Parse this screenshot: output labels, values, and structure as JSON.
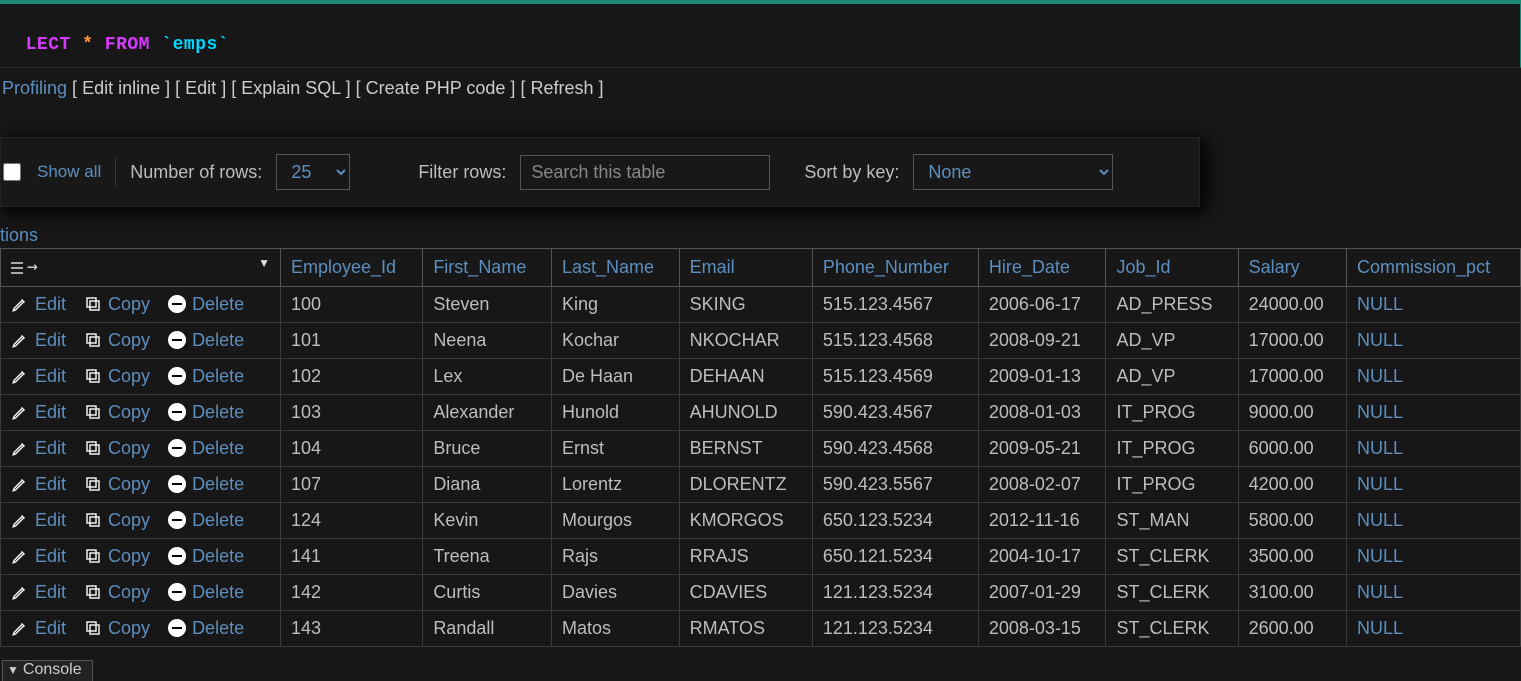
{
  "sql": {
    "kw1": "LECT",
    "star": "*",
    "kw2": "FROM",
    "ident": "`emps`"
  },
  "actions_bar": {
    "profiling": "Profiling",
    "edit_inline": "Edit inline",
    "edit": "Edit",
    "explain": "Explain SQL",
    "create_php": "Create PHP code",
    "refresh": "Refresh"
  },
  "toolbar": {
    "show_all": "Show all",
    "num_rows_label": "Number of rows:",
    "num_rows_value": "25",
    "filter_label": "Filter rows:",
    "filter_placeholder": "Search this table",
    "sort_label": "Sort by key:",
    "sort_value": "None"
  },
  "options_label": "tions",
  "sort_handle_arrow": "→",
  "columns": [
    "Employee_Id",
    "First_Name",
    "Last_Name",
    "Email",
    "Phone_Number",
    "Hire_Date",
    "Job_Id",
    "Salary",
    "Commission_pct"
  ],
  "row_actions": {
    "edit": "Edit",
    "copy": "Copy",
    "delete": "Delete"
  },
  "rows": [
    {
      "Employee_Id": "100",
      "First_Name": "Steven",
      "Last_Name": "King",
      "Email": "SKING",
      "Phone_Number": "515.123.4567",
      "Hire_Date": "2006-06-17",
      "Job_Id": "AD_PRESS",
      "Salary": "24000.00",
      "Commission_pct": "NULL"
    },
    {
      "Employee_Id": "101",
      "First_Name": "Neena",
      "Last_Name": "Kochar",
      "Email": "NKOCHAR",
      "Phone_Number": "515.123.4568",
      "Hire_Date": "2008-09-21",
      "Job_Id": "AD_VP",
      "Salary": "17000.00",
      "Commission_pct": "NULL"
    },
    {
      "Employee_Id": "102",
      "First_Name": "Lex",
      "Last_Name": "De Haan",
      "Email": "DEHAAN",
      "Phone_Number": "515.123.4569",
      "Hire_Date": "2009-01-13",
      "Job_Id": "AD_VP",
      "Salary": "17000.00",
      "Commission_pct": "NULL"
    },
    {
      "Employee_Id": "103",
      "First_Name": "Alexander",
      "Last_Name": "Hunold",
      "Email": "AHUNOLD",
      "Phone_Number": "590.423.4567",
      "Hire_Date": "2008-01-03",
      "Job_Id": "IT_PROG",
      "Salary": "9000.00",
      "Commission_pct": "NULL"
    },
    {
      "Employee_Id": "104",
      "First_Name": "Bruce",
      "Last_Name": "Ernst",
      "Email": "BERNST",
      "Phone_Number": "590.423.4568",
      "Hire_Date": "2009-05-21",
      "Job_Id": "IT_PROG",
      "Salary": "6000.00",
      "Commission_pct": "NULL"
    },
    {
      "Employee_Id": "107",
      "First_Name": "Diana",
      "Last_Name": "Lorentz",
      "Email": "DLORENTZ",
      "Phone_Number": "590.423.5567",
      "Hire_Date": "2008-02-07",
      "Job_Id": "IT_PROG",
      "Salary": "4200.00",
      "Commission_pct": "NULL"
    },
    {
      "Employee_Id": "124",
      "First_Name": "Kevin",
      "Last_Name": "Mourgos",
      "Email": "KMORGOS",
      "Phone_Number": "650.123.5234",
      "Hire_Date": "2012-11-16",
      "Job_Id": "ST_MAN",
      "Salary": "5800.00",
      "Commission_pct": "NULL"
    },
    {
      "Employee_Id": "141",
      "First_Name": "Treena",
      "Last_Name": "Rajs",
      "Email": "RRAJS",
      "Phone_Number": "650.121.5234",
      "Hire_Date": "2004-10-17",
      "Job_Id": "ST_CLERK",
      "Salary": "3500.00",
      "Commission_pct": "NULL"
    },
    {
      "Employee_Id": "142",
      "First_Name": "Curtis",
      "Last_Name": "Davies",
      "Email": "CDAVIES",
      "Phone_Number": "121.123.5234",
      "Hire_Date": "2007-01-29",
      "Job_Id": "ST_CLERK",
      "Salary": "3100.00",
      "Commission_pct": "NULL"
    },
    {
      "Employee_Id": "143",
      "First_Name": "Randall",
      "Last_Name": "Matos",
      "Email": "RMATOS",
      "Phone_Number": "121.123.5234",
      "Hire_Date": "2008-03-15",
      "Job_Id": "ST_CLERK",
      "Salary": "2600.00",
      "Commission_pct": "NULL"
    }
  ],
  "console_label": "Console"
}
